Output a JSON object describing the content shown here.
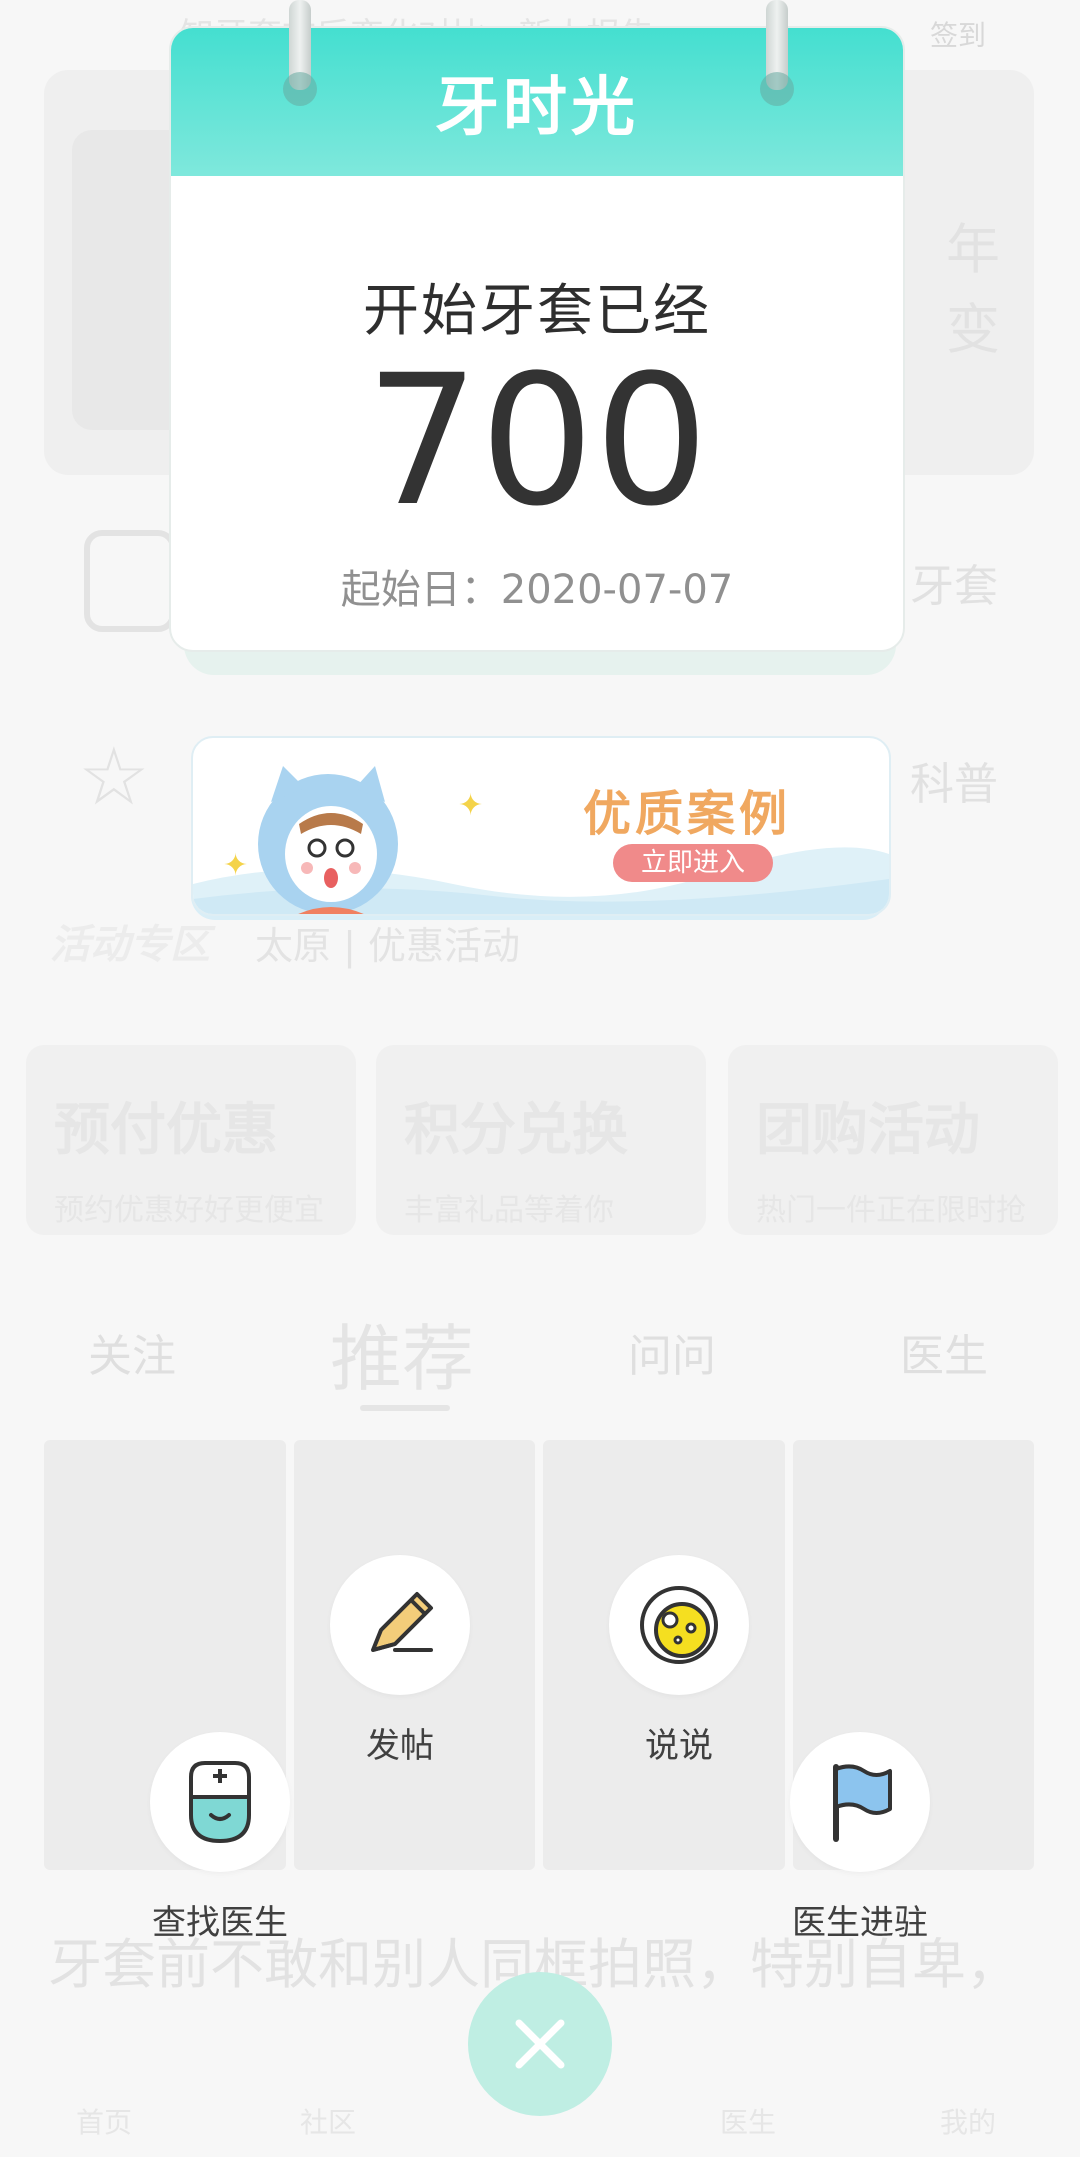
{
  "background": {
    "top_text": "知牙套前后变化对比 · 新人报告",
    "checkin": "签到",
    "banner_right_text": "年\n变",
    "grid_left_top": "",
    "grid_right_top": "牙套",
    "grid_right_bottom": "科普",
    "section_title": "活动专区",
    "section_subtitle": "太原 | 优惠活动",
    "promos": [
      {
        "title": "预付优惠",
        "sub": "预约优惠好好更便宜"
      },
      {
        "title": "积分兑换",
        "sub": "丰富礼品等着你"
      },
      {
        "title": "团购活动",
        "sub": "热门一件正在限时抢"
      }
    ],
    "tabs": [
      "关注",
      "推荐",
      "问问",
      "医生"
    ],
    "post_title": "牙套前不敢和别人同框拍照，特别自卑，",
    "bottom_nav": [
      "首页",
      "社区",
      "医生",
      "我的"
    ]
  },
  "calendar": {
    "title": "牙时光",
    "subtitle": "开始牙套已经",
    "days": "700",
    "start_date": "起始日：2020-07-07"
  },
  "case_banner": {
    "title": "优质案例",
    "button": "立即进入"
  },
  "actions": {
    "post": {
      "label": "发帖",
      "icon": "pencil-icon"
    },
    "talk": {
      "label": "说说",
      "icon": "bubble-icon"
    },
    "find_doctor": {
      "label": "查找医生",
      "icon": "doctor-icon"
    },
    "doctor_join": {
      "label": "医生进驻",
      "icon": "flag-icon"
    }
  },
  "close_icon": "close-icon",
  "colors": {
    "calendar_head": "#44dfd0",
    "case_title": "#f0a860",
    "case_button": "#f08a8a",
    "close_button": "#bfeee3"
  }
}
